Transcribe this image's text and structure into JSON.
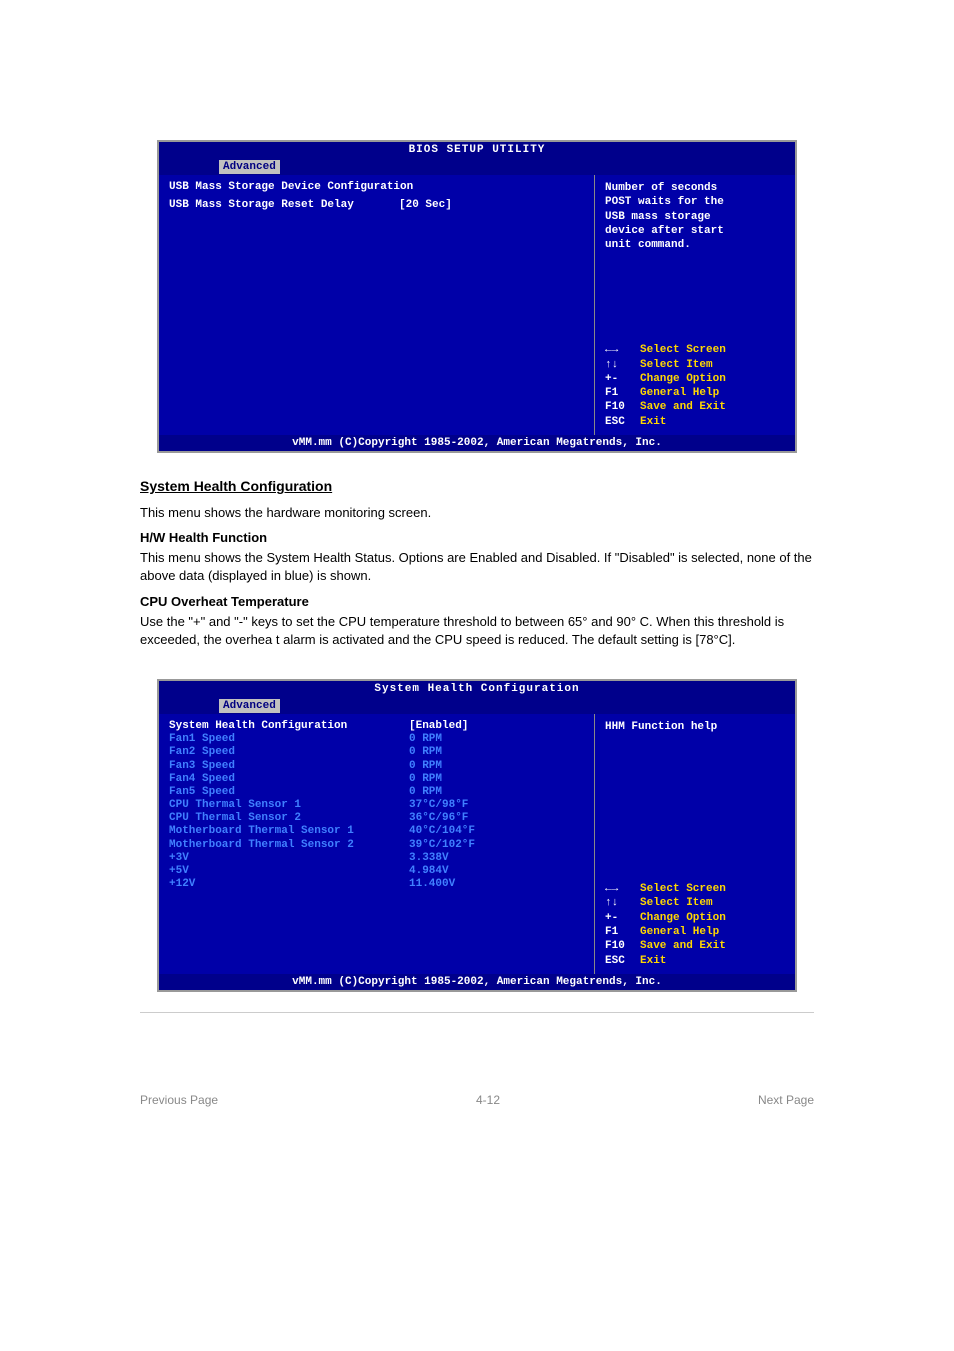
{
  "bios1": {
    "title": "BIOS SETUP UTILITY",
    "tab": "Advanced",
    "section_heading": "USB Mass Storage Device Configuration",
    "item_label": "USB Mass Storage Reset Delay",
    "item_value": "[20 Sec]",
    "help_text_1": "Number of seconds",
    "help_text_2": "POST waits for the",
    "help_text_3": "USB mass storage",
    "help_text_4": "device after start",
    "help_text_5": "unit command.",
    "nav": {
      "k1": "←→",
      "l1": "Select Screen",
      "k2": "↑↓",
      "l2": "Select Item",
      "k3": "+-",
      "l3": "Change Option",
      "k4": "F1",
      "l4": "General Help",
      "k5": "F10",
      "l5": "Save and Exit",
      "k6": "ESC",
      "l6": "Exit"
    },
    "footer": "vMM.mm (C)Copyright 1985-2002, American Megatrends, Inc."
  },
  "doc": {
    "heading1": "System Health Configuration",
    "para1": "This menu shows the hardware monitoring screen.",
    "sub1": "H/W Health Function",
    "para2": "This menu shows the System Health Status. Options are Enabled and Disabled. If \"Disabled\" is selected, none of the above data (displayed in blue) is shown.",
    "sub2": "CPU Overheat Temperature",
    "para3": "Use the \"+\" and \"-\" keys to set the CPU temperature threshold to between 65° and 90° C. When this threshold is exceeded, the overhea t alarm is activated and the CPU speed is reduced. The default setting is [78°C]."
  },
  "bios2": {
    "title": "System Health Configuration",
    "tab": "Advanced",
    "rows": [
      {
        "label": "System Health Configuration",
        "value": "[Enabled]",
        "white": true
      },
      {
        "label": "Fan1 Speed",
        "value": "0 RPM"
      },
      {
        "label": "Fan2 Speed",
        "value": "0 RPM"
      },
      {
        "label": "Fan3 Speed",
        "value": "0 RPM"
      },
      {
        "label": "Fan4 Speed",
        "value": "0 RPM"
      },
      {
        "label": "Fan5 Speed",
        "value": "0 RPM"
      },
      {
        "label": "CPU Thermal Sensor 1",
        "value": "37°C/98°F"
      },
      {
        "label": "CPU Thermal Sensor 2",
        "value": "36°C/96°F"
      },
      {
        "label": "Motherboard Thermal Sensor 1",
        "value": "40°C/104°F"
      },
      {
        "label": "Motherboard Thermal Sensor 2",
        "value": "39°C/102°F"
      },
      {
        "label": "+3V",
        "value": "3.338V"
      },
      {
        "label": "+5V",
        "value": "4.984V"
      },
      {
        "label": "+12V",
        "value": "11.400V"
      }
    ],
    "help_title": "HHM Function help",
    "nav": {
      "k1": "←→",
      "l1": "Select Screen",
      "k2": "↑↓",
      "l2": "Select Item",
      "k3": "+-",
      "l3": "Change Option",
      "k4": "F1",
      "l4": "General Help",
      "k5": "F10",
      "l5": "Save and Exit",
      "k6": "ESC",
      "l6": "Exit"
    },
    "footer": "vMM.mm (C)Copyright 1985-2002, American Megatrends, Inc."
  },
  "page": {
    "prev": "Previous Page",
    "next": "Next Page",
    "num": "4-12"
  }
}
